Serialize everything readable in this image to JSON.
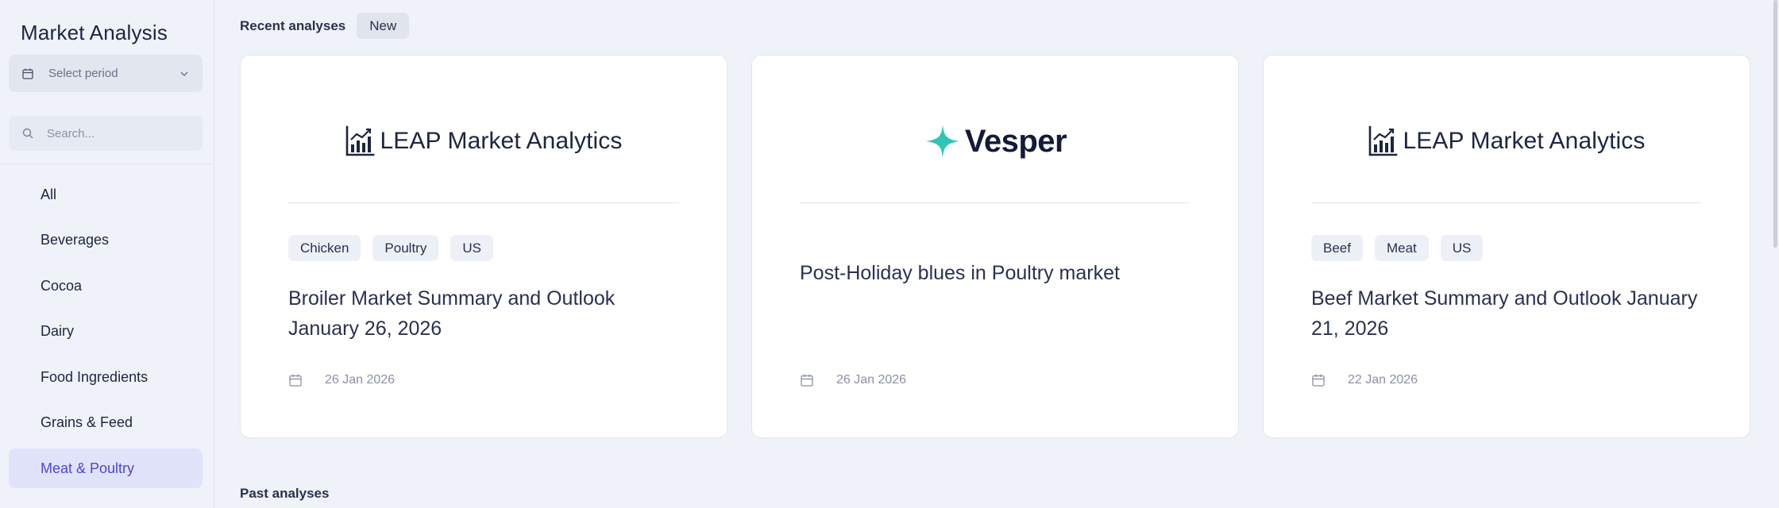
{
  "sidebar": {
    "title": "Market Analysis",
    "period_label": "Select period",
    "search_placeholder": "Search...",
    "items": [
      {
        "label": "All"
      },
      {
        "label": "Beverages"
      },
      {
        "label": "Cocoa"
      },
      {
        "label": "Dairy"
      },
      {
        "label": "Food Ingredients"
      },
      {
        "label": "Grains & Feed"
      },
      {
        "label": "Meat & Poultry"
      }
    ],
    "active_item": "Meat & Poultry"
  },
  "recent": {
    "title": "Recent analyses",
    "new_label": "New",
    "cards": [
      {
        "logo_text": "LEAP Market Analytics",
        "logo_icon": "bar-chart-icon",
        "tags": [
          "Chicken",
          "Poultry",
          "US"
        ],
        "heading": "Broiler Market Summary and Outlook January 26, 2026",
        "date": "26 Jan 2026"
      },
      {
        "logo_text": "Vesper",
        "logo_icon": "sparkle-icon",
        "tags": [],
        "heading": "Post-Holiday blues in Poultry market",
        "date": "26 Jan 2026"
      },
      {
        "logo_text": "LEAP Market Analytics",
        "logo_icon": "bar-chart-icon",
        "tags": [
          "Beef",
          "Meat",
          "US"
        ],
        "heading": "Beef Market Summary and Outlook January 21, 2026",
        "date": "22 Jan 2026"
      }
    ]
  },
  "past": {
    "title": "Past analyses"
  },
  "colors": {
    "background": "#eff2f8",
    "active_nav_bg": "#e1e3fb",
    "active_nav_text": "#4c46d6",
    "vesper_accent": "#2ec4b6"
  }
}
